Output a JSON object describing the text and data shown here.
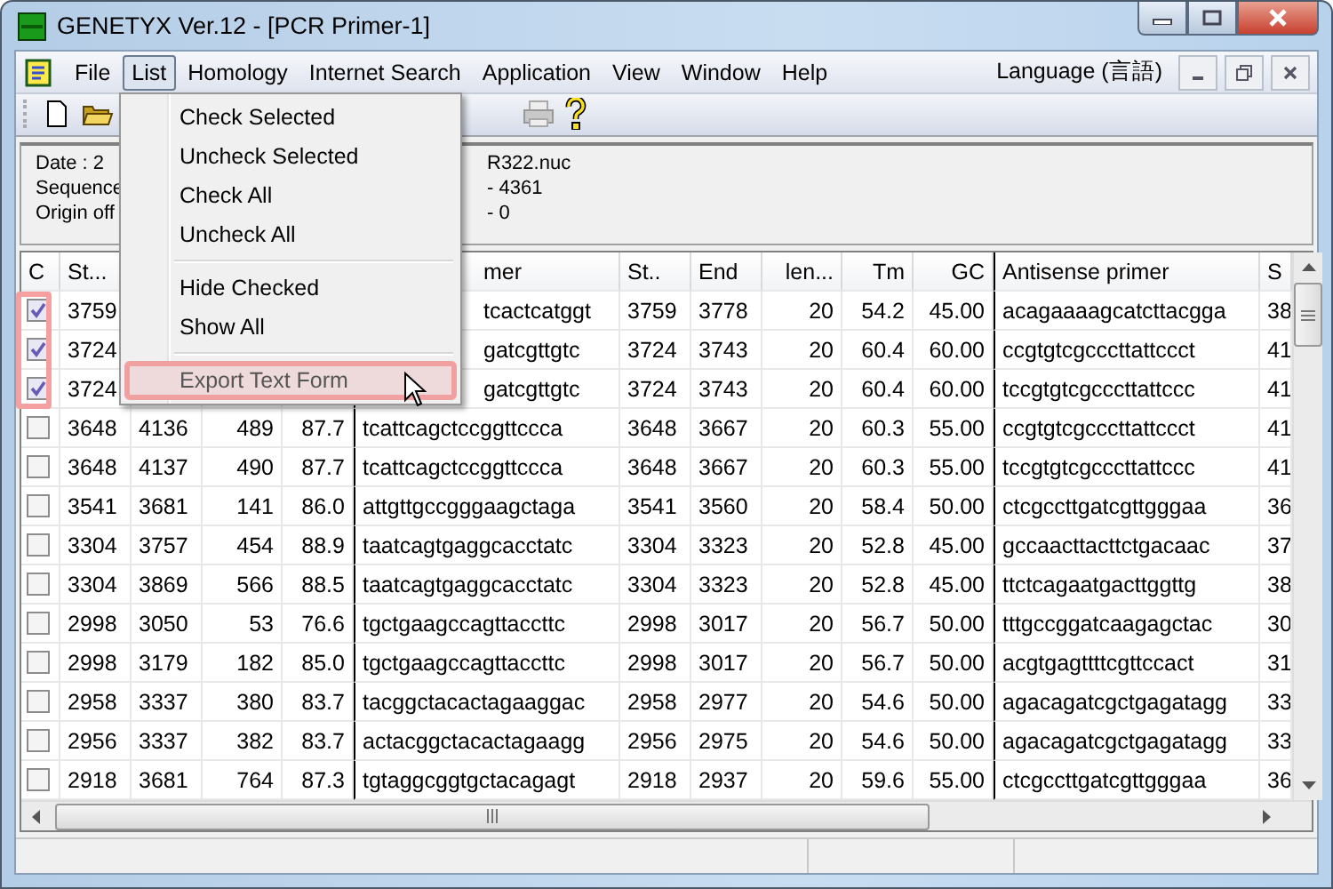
{
  "window": {
    "title": "GENETYX Ver.12 - [PCR Primer-1]"
  },
  "menubar": {
    "items": [
      {
        "label": "File",
        "selected": false
      },
      {
        "label": "List",
        "selected": true
      },
      {
        "label": "Homology",
        "selected": false
      },
      {
        "label": "Internet Search",
        "selected": false
      },
      {
        "label": "Application",
        "selected": false
      },
      {
        "label": "View",
        "selected": false
      },
      {
        "label": "Window",
        "selected": false
      },
      {
        "label": "Help",
        "selected": false
      }
    ],
    "language": "Language (言語)"
  },
  "menu": {
    "items": [
      {
        "kind": "item",
        "label": "Check Selected",
        "selected": false
      },
      {
        "kind": "item",
        "label": "Uncheck Selected",
        "selected": false
      },
      {
        "kind": "item",
        "label": "Check All",
        "selected": false
      },
      {
        "kind": "item",
        "label": "Uncheck All",
        "selected": false
      },
      {
        "kind": "separator"
      },
      {
        "kind": "item",
        "label": "Hide Checked",
        "selected": false
      },
      {
        "kind": "item",
        "label": "Show All",
        "selected": false
      },
      {
        "kind": "separator"
      },
      {
        "kind": "item",
        "label": "Export Text Form",
        "selected": true
      }
    ]
  },
  "info": {
    "labels": [
      "Date :  2",
      "Sequence",
      "Origin off"
    ],
    "values": [
      "R322.nuc",
      "- 4361",
      "- 0"
    ]
  },
  "table": {
    "check_header": "C",
    "columns": [
      {
        "label": "St..."
      },
      {},
      {},
      {},
      {
        "label": "mer"
      },
      {
        "label": "St.."
      },
      {
        "label": "End"
      },
      {
        "label": "len..."
      },
      {
        "label": "Tm"
      },
      {
        "label": "GC"
      },
      {
        "label": "Antisense primer"
      },
      {
        "label": "S"
      }
    ],
    "rows": [
      {
        "checked": true,
        "cells": [
          "3759",
          null,
          null,
          null,
          "tcactcatggt",
          "3759",
          "3778",
          "20",
          "54.2",
          "45.00",
          "acagaaaagcatcttacgga",
          "38"
        ]
      },
      {
        "checked": true,
        "cells": [
          "3724",
          null,
          null,
          null,
          "gatcgttgtc",
          "3724",
          "3743",
          "20",
          "60.4",
          "60.00",
          "ccgtgtcgcccttattccct",
          "41"
        ]
      },
      {
        "checked": true,
        "cells": [
          "3724",
          null,
          null,
          null,
          "gatcgttgtc",
          "3724",
          "3743",
          "20",
          "60.4",
          "60.00",
          "tccgtgtcgcccttattccc",
          "41"
        ]
      },
      {
        "checked": false,
        "cells": [
          "3648",
          "4136",
          "489",
          "87.7",
          "tcattcagctccggttccca",
          "3648",
          "3667",
          "20",
          "60.3",
          "55.00",
          "ccgtgtcgcccttattccct",
          "41"
        ]
      },
      {
        "checked": false,
        "cells": [
          "3648",
          "4137",
          "490",
          "87.7",
          "tcattcagctccggttccca",
          "3648",
          "3667",
          "20",
          "60.3",
          "55.00",
          "tccgtgtcgcccttattccc",
          "41"
        ]
      },
      {
        "checked": false,
        "cells": [
          "3541",
          "3681",
          "141",
          "86.0",
          "attgttgccgggaagctaga",
          "3541",
          "3560",
          "20",
          "58.4",
          "50.00",
          "ctcgccttgatcgttgggaa",
          "36"
        ]
      },
      {
        "checked": false,
        "cells": [
          "3304",
          "3757",
          "454",
          "88.9",
          "taatcagtgaggcacctatc",
          "3304",
          "3323",
          "20",
          "52.8",
          "45.00",
          "gccaacttacttctgacaac",
          "37"
        ]
      },
      {
        "checked": false,
        "cells": [
          "3304",
          "3869",
          "566",
          "88.5",
          "taatcagtgaggcacctatc",
          "3304",
          "3323",
          "20",
          "52.8",
          "45.00",
          "ttctcagaatgacttggttg",
          "38"
        ]
      },
      {
        "checked": false,
        "cells": [
          "2998",
          "3050",
          "53",
          "76.6",
          "tgctgaagccagttaccttc",
          "2998",
          "3017",
          "20",
          "56.7",
          "50.00",
          "tttgccggatcaagagctac",
          "30"
        ]
      },
      {
        "checked": false,
        "cells": [
          "2998",
          "3179",
          "182",
          "85.0",
          "tgctgaagccagttaccttc",
          "2998",
          "3017",
          "20",
          "56.7",
          "50.00",
          "acgtgagttttcgttccact",
          "31"
        ]
      },
      {
        "checked": false,
        "cells": [
          "2958",
          "3337",
          "380",
          "83.7",
          "tacggctacactagaaggac",
          "2958",
          "2977",
          "20",
          "54.6",
          "50.00",
          "agacagatcgctgagatagg",
          "33"
        ]
      },
      {
        "checked": false,
        "cells": [
          "2956",
          "3337",
          "382",
          "83.7",
          "actacggctacactagaagg",
          "2956",
          "2975",
          "20",
          "54.6",
          "50.00",
          "agacagatcgctgagatagg",
          "33"
        ]
      },
      {
        "checked": false,
        "cells": [
          "2918",
          "3681",
          "764",
          "87.3",
          "tgtaggcggtgctacagagt",
          "2918",
          "2937",
          "20",
          "59.6",
          "55.00",
          "ctcgccttgatcgttgggaa",
          "36"
        ]
      }
    ]
  }
}
